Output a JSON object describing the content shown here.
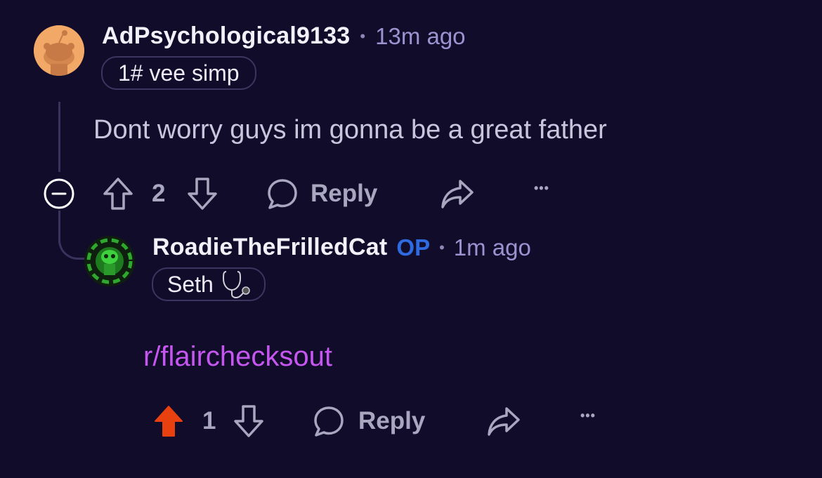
{
  "comments": [
    {
      "username": "AdPsychological9133",
      "separator": "•",
      "time": "13m ago",
      "flair": "1# vee simp",
      "body": "Dont worry guys im gonna be a great father",
      "score": "2",
      "reply_label": "Reply",
      "more_label": "•••"
    },
    {
      "username": "RoadieTheFrilledCat",
      "op_badge": "OP",
      "separator": "•",
      "time": "1m ago",
      "flair": "Seth",
      "body": "r/flairchecksout",
      "score": "1",
      "reply_label": "Reply",
      "more_label": "•••",
      "upvoted": true
    }
  ],
  "colors": {
    "background": "#120c2b",
    "upvote_active": "#e8400f",
    "op": "#2f6be0",
    "link": "#c557f0",
    "time": "#9b93d0"
  }
}
